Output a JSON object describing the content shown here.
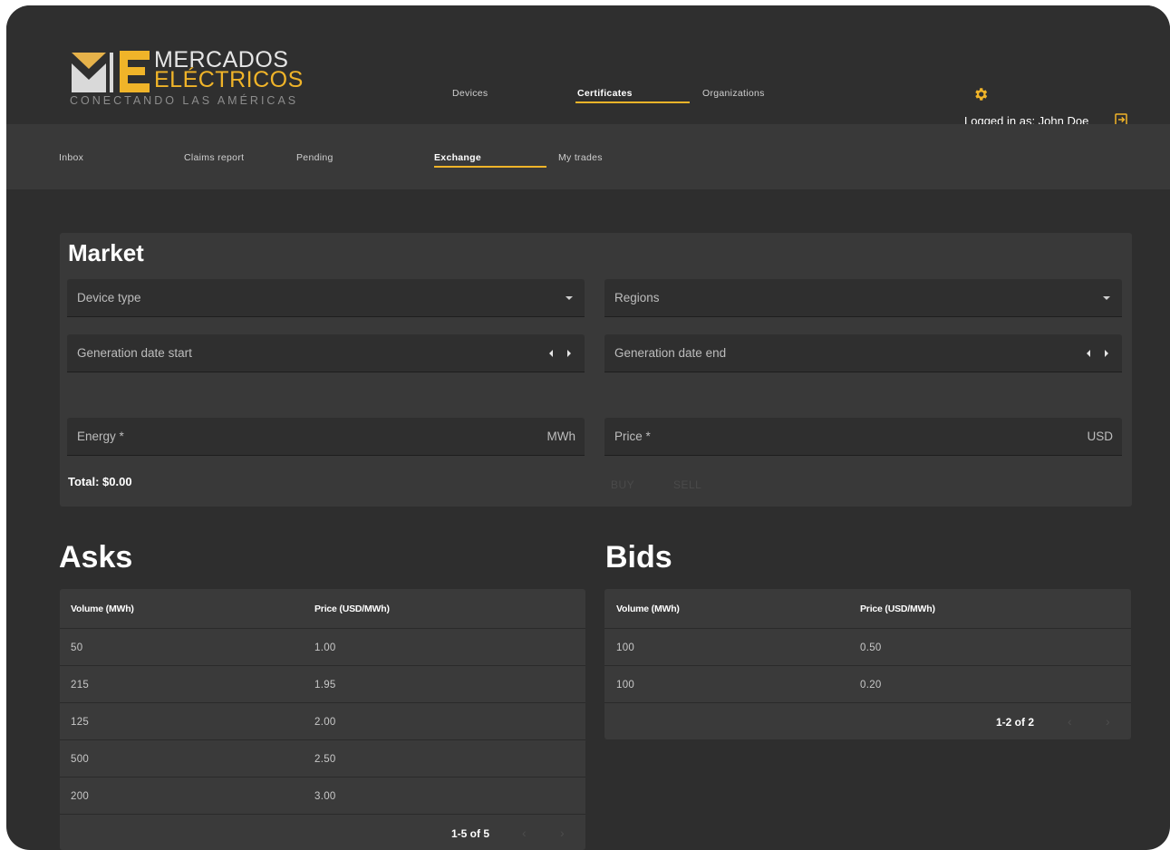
{
  "brand": {
    "line1": "MERCADOS",
    "line2": "ELÉCTRICOS",
    "tagline": "CONECTANDO LAS AMÉRICAS",
    "accent_color": "#f0b429"
  },
  "top_nav": {
    "devices": "Devices",
    "certificates": "Certificates",
    "organizations": "Organizations",
    "active": "certificates"
  },
  "user": {
    "logged_in_text": "Logged in as: John Doe",
    "settings_icon": "gear-icon",
    "logout_icon": "logout-icon"
  },
  "sub_nav": {
    "inbox": "Inbox",
    "claims_report": "Claims report",
    "pending": "Pending",
    "exchange": "Exchange",
    "my_trades": "My trades",
    "active": "exchange"
  },
  "market": {
    "title": "Market",
    "device_type": "Device type",
    "regions": "Regions",
    "generation_date_start": "Generation date start",
    "generation_date_end": "Generation date end",
    "energy_label": "Energy *",
    "energy_unit": "MWh",
    "price_label": "Price *",
    "price_unit": "USD",
    "total": "Total: $0.00",
    "buy_button": "BUY",
    "sell_button": "SELL"
  },
  "asks": {
    "title": "Asks",
    "columns": [
      "Volume (MWh)",
      "Price (USD/MWh)"
    ],
    "rows": [
      [
        "50",
        "1.00"
      ],
      [
        "215",
        "1.95"
      ],
      [
        "125",
        "2.00"
      ],
      [
        "500",
        "2.50"
      ],
      [
        "200",
        "3.00"
      ]
    ],
    "pagination": "1-5 of 5",
    "prev": "‹",
    "next": "›"
  },
  "bids": {
    "title": "Bids",
    "columns": [
      "Volume (MWh)",
      "Price (USD/MWh)"
    ],
    "rows": [
      [
        "100",
        "0.50"
      ],
      [
        "100",
        "0.20"
      ]
    ],
    "pagination": "1-2 of 2",
    "prev": "‹",
    "next": "›"
  }
}
